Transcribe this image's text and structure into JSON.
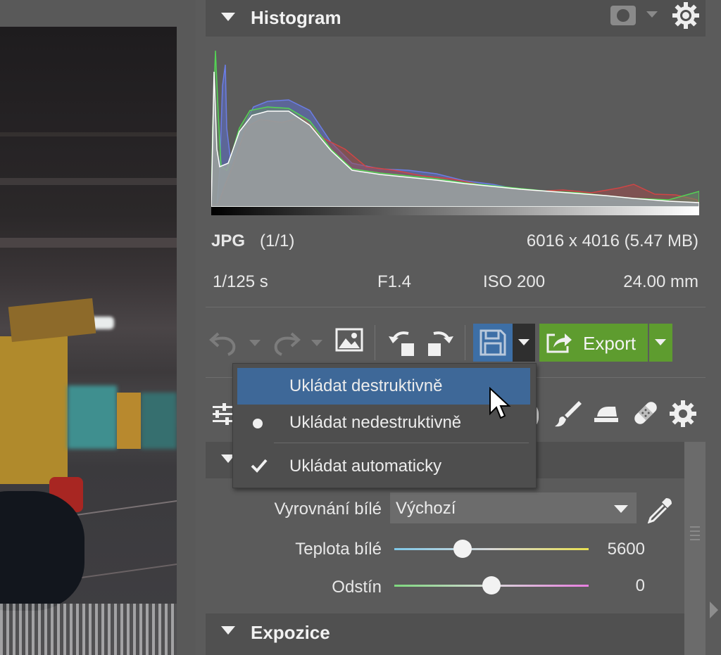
{
  "histogram": {
    "title": "Histogram",
    "mask_icon": "mask-icon",
    "settings_icon": "gear-icon"
  },
  "file_info": {
    "format": "JPG",
    "index": "(1/1)",
    "dimensions": "6016 x 4016 (5.47 MB)",
    "shutter": "1/125 s",
    "aperture": "F1.4",
    "iso": "ISO 200",
    "focal_length": "24.00 mm"
  },
  "toolbar": {
    "undo_icon": "undo-icon",
    "redo_icon": "redo-icon",
    "image_icon": "image-icon",
    "rotate_left_icon": "rotate-left-icon",
    "rotate_right_icon": "rotate-right-icon",
    "save_icon": "floppy-icon",
    "export_label": "Export",
    "export_icon": "share-icon"
  },
  "save_menu": {
    "items": [
      {
        "label": "Ukládat destruktivně",
        "highlighted": true,
        "marker": ""
      },
      {
        "label": "Ukládat nedestruktivně",
        "highlighted": false,
        "marker": "bullet"
      },
      {
        "label": "Ukládat automaticky",
        "highlighted": false,
        "marker": "check"
      }
    ]
  },
  "tools": [
    "sliders-icon",
    "brush-icon",
    "iron-icon",
    "bandage-icon",
    "gear-icon"
  ],
  "white_balance": {
    "mode_label": "Vyrovnání bílé",
    "mode_value": "Výchozí",
    "temperature_label": "Teplota bílé",
    "temperature_value": "5600",
    "temperature_level": 0.35,
    "tint_label": "Odstín",
    "tint_value": "0",
    "tint_level": 0.5
  },
  "exposure": {
    "title": "Expozice"
  },
  "colors": {
    "accent_blue": "#3e6898",
    "export_green": "#5e9c2f",
    "panel_bg": "#5b5b5b",
    "section_bg": "#505050"
  }
}
